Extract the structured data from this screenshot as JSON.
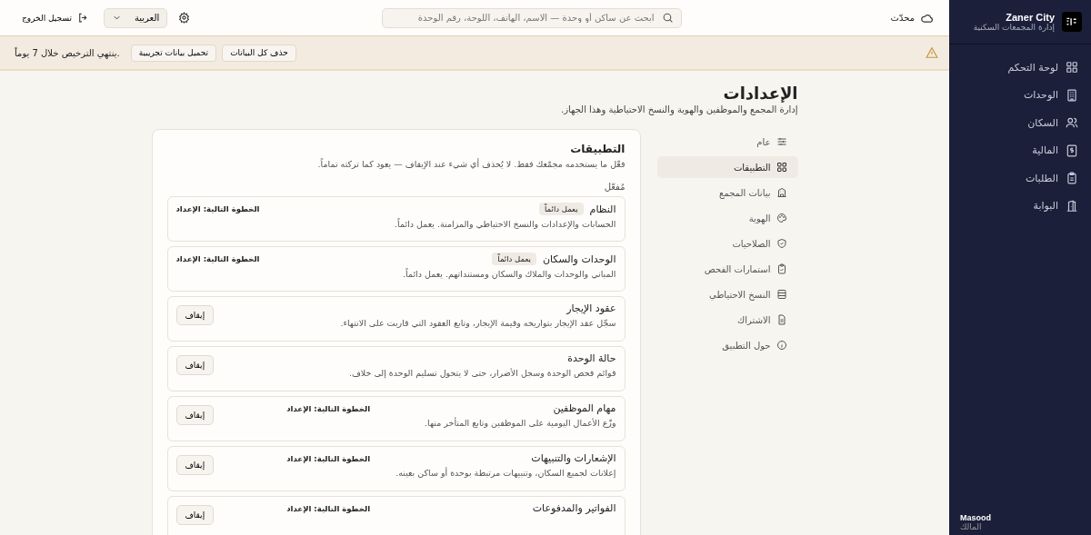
{
  "sidebar": {
    "brand": "Zaner City",
    "subtitle": "إدارة المجمعات السكنية",
    "items": [
      {
        "label": "لوحة التحكم"
      },
      {
        "label": "الوحدات"
      },
      {
        "label": "السكان"
      },
      {
        "label": "المالية"
      },
      {
        "label": "الطلبات"
      },
      {
        "label": "البوابة"
      }
    ],
    "user": {
      "name": "Masood",
      "role": "المالك"
    }
  },
  "topbar": {
    "sync_status": "محدّث",
    "search": {
      "placeholder": "ابحث عن ساكن أو وحدة — الاسم، الهاتف، اللوحة، رقم الوحدة"
    },
    "language": "العربية",
    "logout": "تسجيل الخروج"
  },
  "banner": {
    "buttons": [
      "حذف كل البيانات",
      "تحميل بيانات تجريبية"
    ],
    "message": "ينتهي الترخيص خلال 7 يوماً."
  },
  "page": {
    "title": "الإعدادات",
    "subtitle": "إدارة المجمع والموظفين والهوية والنسخ الاحتياطية وهذا الجهاز."
  },
  "settings_nav": [
    {
      "label": "عام",
      "selected": false
    },
    {
      "label": "التطبيقات",
      "selected": true
    },
    {
      "label": "بيانات المجمع",
      "selected": false
    },
    {
      "label": "الهوية",
      "selected": false
    },
    {
      "label": "الصلاحيات",
      "selected": false
    },
    {
      "label": "استمارات الفحص",
      "selected": false
    },
    {
      "label": "النسخ الاحتياطي",
      "selected": false
    },
    {
      "label": "الاشتراك",
      "selected": false
    },
    {
      "label": "حول التطبيق",
      "selected": false
    }
  ],
  "apps_panel": {
    "title": "التطبيقات",
    "description": "فعّل ما يستخدمه مجمّعك فقط. لا يُحذف أي شيء عند الإيقاف — يعود كما تركته تماماً.",
    "section_label": "مُفعّل",
    "apps": [
      {
        "kind": "core",
        "name": "النظام",
        "badge": "يعمل دائماً",
        "next_step": "الخطوة التالية: الإعداد",
        "description": "الحسابات والإعدادات والنسخ الاحتياطي والمزامنة. يعمل دائماً."
      },
      {
        "kind": "core",
        "name": "الوحدات والسكان",
        "badge": "يعمل دائماً",
        "next_step": "الخطوة التالية: الإعداد",
        "description": "المباني والوحدات والملاك والسكان ومستنداتهم. يعمل دائماً."
      },
      {
        "kind": "optional",
        "name": "عقود الإيجار",
        "button": "إيقاف",
        "description": "سجّل عقد الإيجار بتواريخه وقيمة الإيجار، وتابع العقود التي قاربت على الانتهاء."
      },
      {
        "kind": "optional",
        "name": "حالة الوحدة",
        "button": "إيقاف",
        "description": "قوائم فحص الوحدة وسجل الأضرار، حتى لا يتحول تسليم الوحدة إلى خلاف."
      },
      {
        "kind": "optional",
        "name": "مهام الموظفين",
        "button": "إيقاف",
        "next_step": "الخطوة التالية: الإعداد",
        "description": "وزّع الأعمال اليومية على الموظفين وتابع المتأخر منها."
      },
      {
        "kind": "optional",
        "name": "الإشعارات والتنبيهات",
        "button": "إيقاف",
        "next_step": "الخطوة التالية: الإعداد",
        "description": "إعلانات لجميع السكان، وتنبيهات مرتبطة بوحدة أو ساكن بعينه."
      },
      {
        "kind": "optional",
        "name": "الفواتير والمدفوعات",
        "button": "إيقاف",
        "next_step": "الخطوة التالية: الإعداد"
      }
    ]
  }
}
